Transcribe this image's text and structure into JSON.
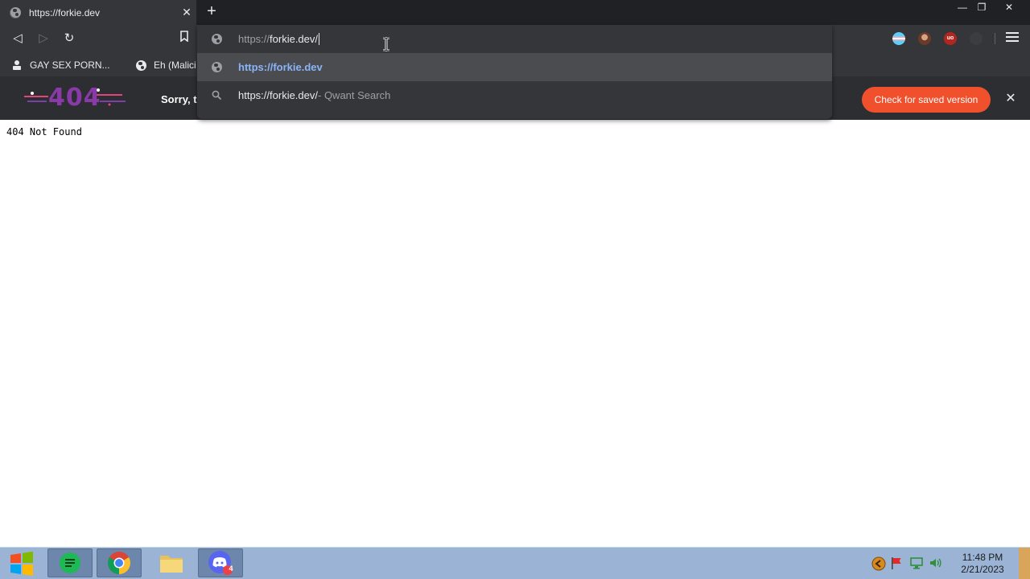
{
  "tab": {
    "title": "https://forkie.dev",
    "close": "✕",
    "new_tab": "+"
  },
  "window_controls": {
    "minimize": "—",
    "restore": "❐",
    "close": "✕"
  },
  "toolbar": {
    "back": "◁",
    "forward": "▷",
    "reload": "↻",
    "bookmark": "🔖"
  },
  "bookmarks": [
    {
      "label": "GAY SEX PORN...",
      "icon": "user-icon"
    },
    {
      "label": "Eh (Malici",
      "icon": "globe-icon"
    }
  ],
  "banner": {
    "logo_text": "404",
    "message": "Sorry, t",
    "saved_button": "Check for saved version",
    "close": "✕"
  },
  "omnibox": {
    "input_prefix": "https://",
    "input_host": "forkie.dev/",
    "suggestion_url": "https://forkie.dev",
    "search_query": "https://forkie.dev/",
    "search_suffix": " - Qwant Search"
  },
  "page": {
    "not_found_text": "404 Not Found"
  },
  "taskbar": {
    "time": "11:48 PM",
    "date": "2/21/2023",
    "discord_badge": "4"
  },
  "colors": {
    "accent_orange": "#f0512c",
    "link_blue": "#8ab4f8",
    "chrome_dark": "#35363a"
  }
}
